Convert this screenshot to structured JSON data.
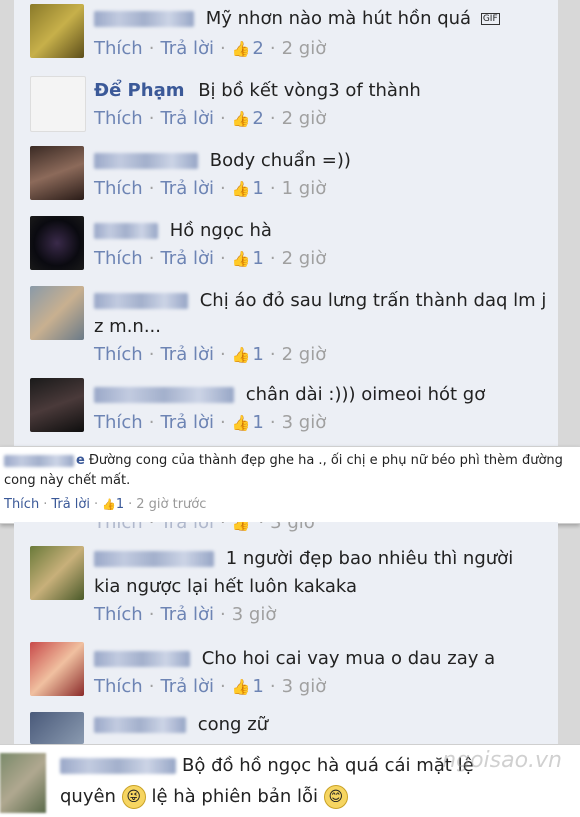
{
  "actions": {
    "like": "Thích",
    "reply": "Trả lời",
    "sep": "·"
  },
  "comments": [
    {
      "author": "",
      "text": "Mỹ nhơn nào mà hút hồn quá",
      "badge": "GIF",
      "likes": "2",
      "time": "2 giờ"
    },
    {
      "author": "Để Phạm",
      "text": "Bị bồ kết vòng3 of thành",
      "likes": "2",
      "time": "2 giờ"
    },
    {
      "author": "",
      "text": "Body chuẩn =))",
      "likes": "1",
      "time": "1 giờ"
    },
    {
      "author": "",
      "text": "Hồ ngọc hà",
      "likes": "1",
      "time": "2 giờ"
    },
    {
      "author": "",
      "text": "Chị áo đỏ sau lưng trấn thành daq lm j",
      "text2": "z m.n...",
      "likes": "1",
      "time": "2 giờ"
    },
    {
      "author": "",
      "text": "chân dài :))) oimeoi hót gơ",
      "likes": "1",
      "time": "3 giờ"
    },
    {
      "author": "",
      "text": "1 người đẹp bao nhiêu thì người",
      "text2": "kia ngược lại hết luôn kakaka",
      "likes": "",
      "time": "3 giờ"
    },
    {
      "author": "",
      "text": "Cho hoi cai vay mua o dau zay a",
      "likes": "1",
      "time": "3 giờ"
    },
    {
      "author": "",
      "text": "cong zữ"
    }
  ],
  "popup": {
    "text": "Đường cong của thành đẹp ghe ha ., ối chị e phụ nữ béo phì thèm đường cong này chết mất.",
    "author_suffix": "e",
    "like": "Thích",
    "reply": "Trả lời",
    "likes": "1",
    "time": "2 giờ trước"
  },
  "bottom": {
    "text": "Bộ đồ hồ ngọc hà quá cái mặt lệ",
    "text2_a": "quyên",
    "text2_b": "lệ hà phiên bản lỗi"
  },
  "watermark": "ngoisao.vn",
  "icons": {
    "like": "thumbs-up-icon",
    "emoji": "smiley-icon"
  },
  "colors": {
    "panel": "#eceff5",
    "link": "#6d84b4",
    "author": "#3b5998"
  }
}
